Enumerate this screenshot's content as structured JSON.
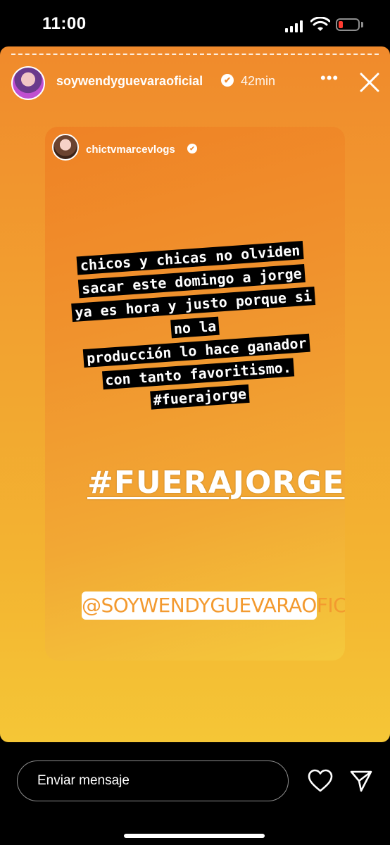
{
  "status_bar": {
    "time": "11:00"
  },
  "story": {
    "owner_username": "soywendyguevaraoficial",
    "verified_mark": "✔",
    "time_ago": "42min",
    "more_symbol": "•••",
    "shared_post": {
      "username": "chictvmarcevlogs",
      "caption_lines": [
        "chicos y chicas no olviden",
        "sacar este domingo a jorge",
        "ya es hora y justo porque si",
        "no la",
        "producción lo hace ganador",
        "con tanto favoritismo.",
        "#fuerajorge"
      ]
    },
    "hashtag_sticker": "#FUERAJORGE",
    "mention_sticker": "@SOYWENDYGUEVARAOFICIAL"
  },
  "reply_bar": {
    "placeholder": "Enviar mensaje"
  },
  "icons": {
    "close": "close-icon",
    "heart": "heart-icon",
    "send": "send-icon",
    "more": "more-icon"
  },
  "colors": {
    "story_top": "#f08a2c",
    "story_bottom": "#f5c636",
    "battery_low": "#ff3b30"
  }
}
